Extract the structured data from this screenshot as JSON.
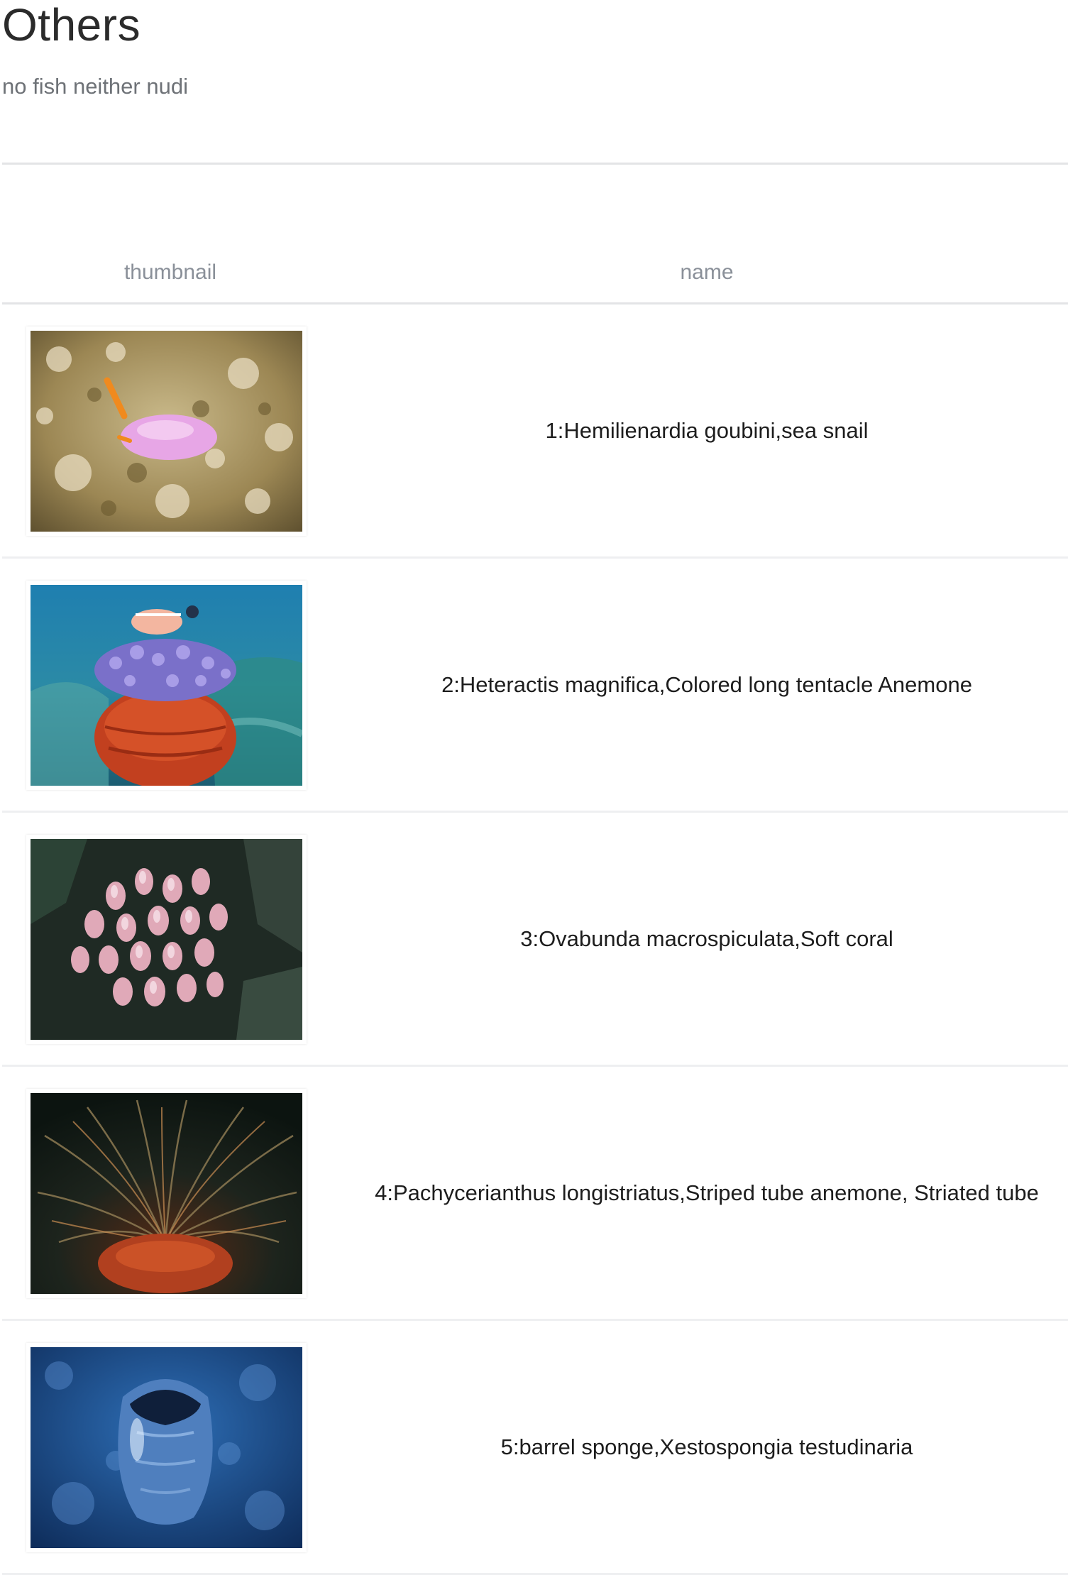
{
  "page": {
    "title": "Others",
    "subtitle": "no fish neither nudi"
  },
  "table": {
    "columns": [
      "thumbnail",
      "name"
    ],
    "rows": [
      {
        "name": "1:Hemilienardia goubini,sea snail",
        "thumbnail_icon": "sea-snail-photo"
      },
      {
        "name": "2:Heteractis magnifica,Colored long tentacle Anemone",
        "thumbnail_icon": "anemone-photo"
      },
      {
        "name": "3:Ovabunda macrospiculata,Soft coral",
        "thumbnail_icon": "soft-coral-photo"
      },
      {
        "name": "4:Pachycerianthus longistriatus,Striped tube anemone, Striated tube",
        "thumbnail_icon": "tube-anemone-photo"
      },
      {
        "name": "5:barrel sponge,Xestospongia testudinaria",
        "thumbnail_icon": "barrel-sponge-photo"
      }
    ]
  },
  "colors": {
    "title": "#2b2b2b",
    "subtitle": "#6e7277",
    "header_text": "#8a9099",
    "divider": "#e3e4e6"
  }
}
